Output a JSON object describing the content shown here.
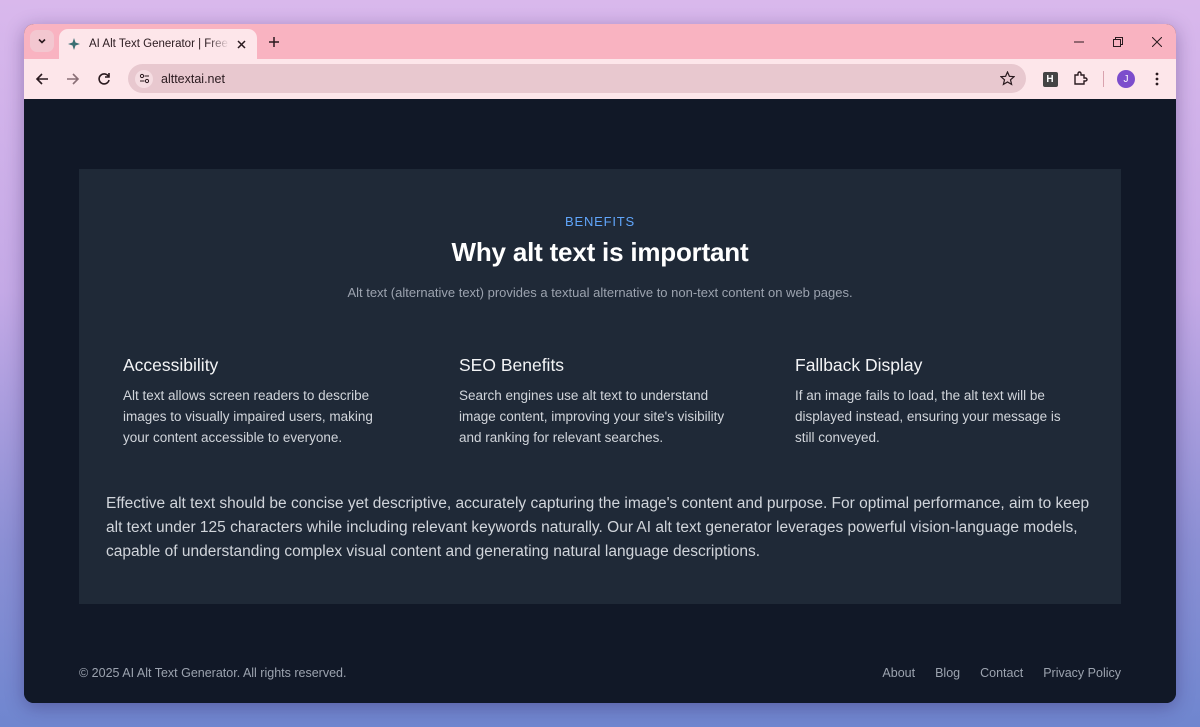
{
  "browser": {
    "tab_title": "AI Alt Text Generator | Free Tool",
    "url": "alttextai.net",
    "profile_initial": "J",
    "extension_label": "H"
  },
  "benefits": {
    "eyebrow": "BENEFITS",
    "headline": "Why alt text is important",
    "subline": "Alt text (alternative text) provides a textual alternative to non-text content on web pages.",
    "features": [
      {
        "title": "Accessibility",
        "description": "Alt text allows screen readers to describe images to visually impaired users, making your content accessible to everyone."
      },
      {
        "title": "SEO Benefits",
        "description": "Search engines use alt text to understand image content, improving your site's visibility and ranking for relevant searches."
      },
      {
        "title": "Fallback Display",
        "description": "If an image fails to load, the alt text will be displayed instead, ensuring your message is still conveyed."
      }
    ],
    "summary": "Effective alt text should be concise yet descriptive, accurately capturing the image's content and purpose. For optimal performance, aim to keep alt text under 125 characters while including relevant keywords naturally. Our AI alt text generator leverages powerful vision-language models, capable of understanding complex visual content and generating natural language descriptions."
  },
  "footer": {
    "copyright": "© 2025 AI Alt Text Generator. All rights reserved.",
    "links": [
      "About",
      "Blog",
      "Contact",
      "Privacy Policy"
    ]
  },
  "colors": {
    "page_bg": "#111827",
    "card_bg": "#1f2937",
    "accent": "#60a5fa",
    "tabstrip": "#f9b3c1"
  }
}
